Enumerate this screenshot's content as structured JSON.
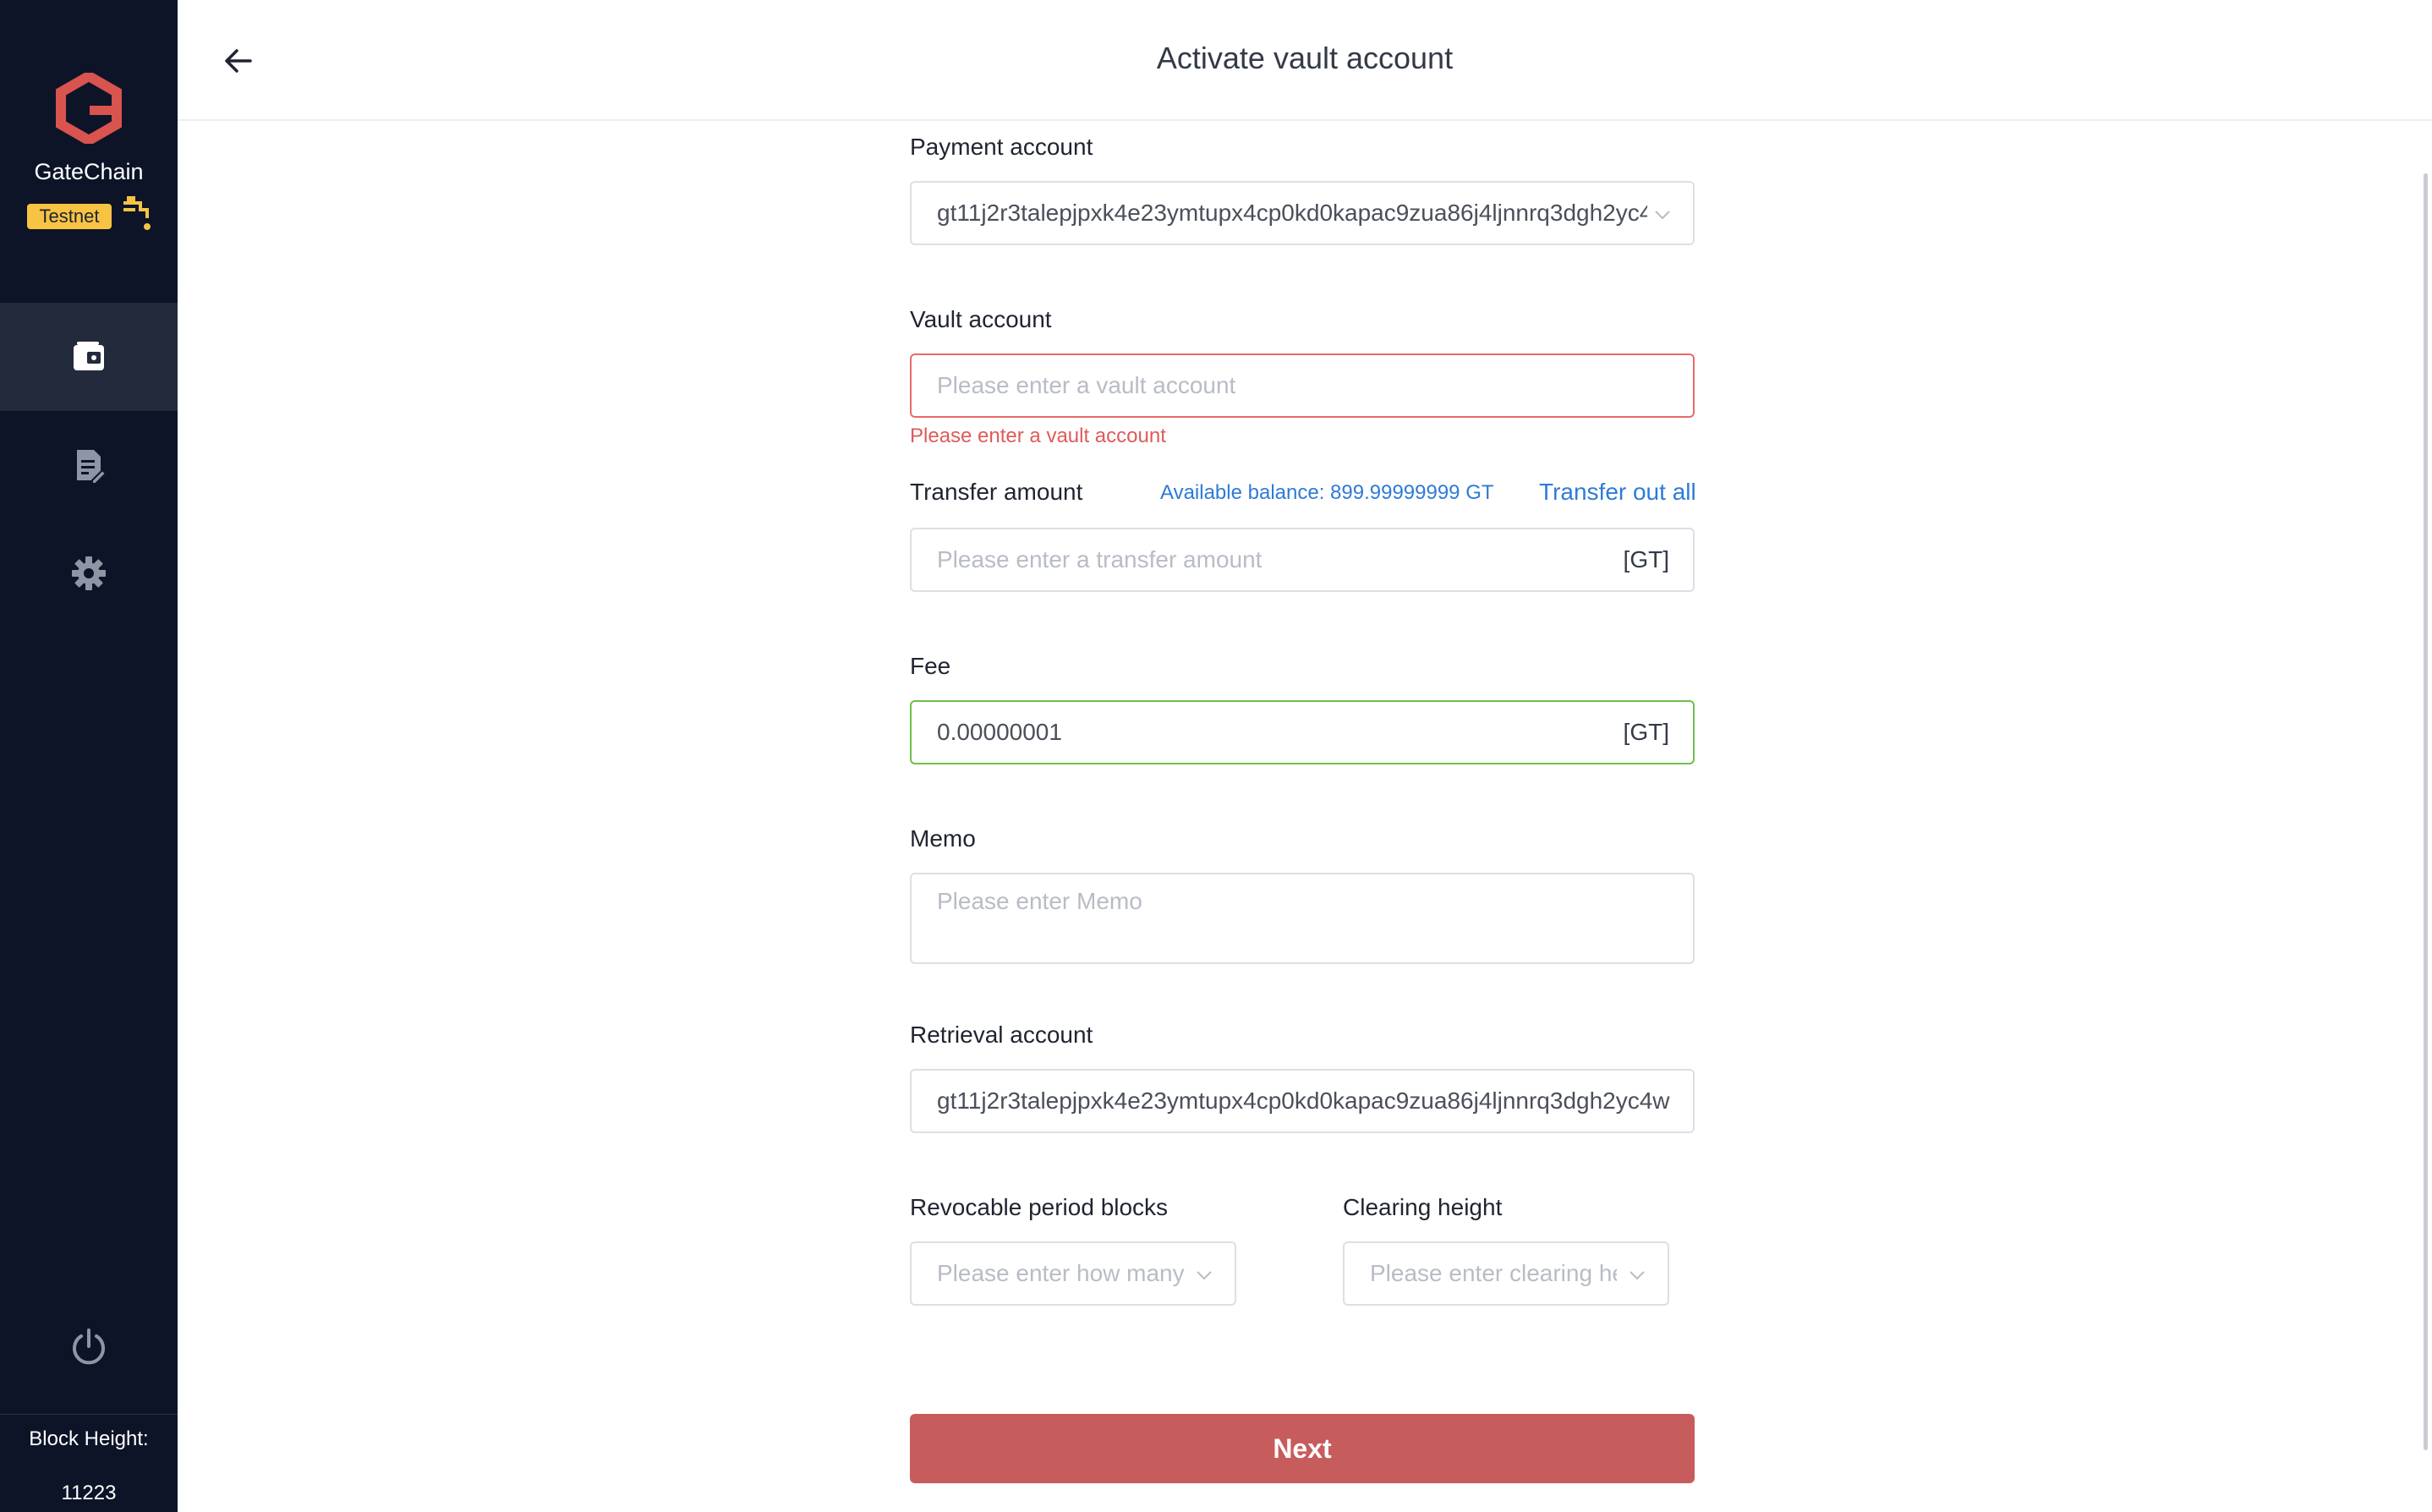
{
  "app": {
    "brand": "GateChain",
    "network_badge": "Testnet",
    "block_height_label": "Block Height:",
    "block_height_value": "11223"
  },
  "header": {
    "title": "Activate vault account"
  },
  "form": {
    "payment_account": {
      "label": "Payment account",
      "value": "gt11j2r3talepjpxk4e23ymtupx4cp0kd0kapac9zua86j4ljnnrq3dgh2yc4"
    },
    "vault_account": {
      "label": "Vault account",
      "placeholder": "Please enter a vault account",
      "error": "Please enter a vault account"
    },
    "transfer_amount": {
      "label": "Transfer amount",
      "available_balance": "Available balance: 899.99999999 GT",
      "transfer_out_all": "Transfer out all",
      "placeholder": "Please enter a transfer amount",
      "unit": "[GT]"
    },
    "fee": {
      "label": "Fee",
      "value": "0.00000001",
      "unit": "[GT]"
    },
    "memo": {
      "label": "Memo",
      "placeholder": "Please enter Memo"
    },
    "retrieval_account": {
      "label": "Retrieval account",
      "value": "gt11j2r3talepjpxk4e23ymtupx4cp0kd0kapac9zua86j4ljnnrq3dgh2yc4w"
    },
    "revocable_period": {
      "label": "Revocable period blocks",
      "placeholder": "Please enter how many"
    },
    "clearing_height": {
      "label": "Clearing height",
      "placeholder": "Please enter clearing he"
    },
    "next_label": "Next"
  },
  "colors": {
    "sidebar_bg": "#0d1428",
    "brand_red": "#c75c5c",
    "error": "#e05a5a",
    "success": "#6cc04a",
    "link": "#2d7bd6",
    "badge": "#f6c343"
  },
  "icons": {
    "logo": "gatechain-logo-icon",
    "faucet": "faucet-icon",
    "wallet": "wallet-icon",
    "document": "document-edit-icon",
    "settings": "gear-icon",
    "power": "power-icon",
    "back": "arrow-left-icon",
    "dropdown": "chevron-down-icon"
  }
}
